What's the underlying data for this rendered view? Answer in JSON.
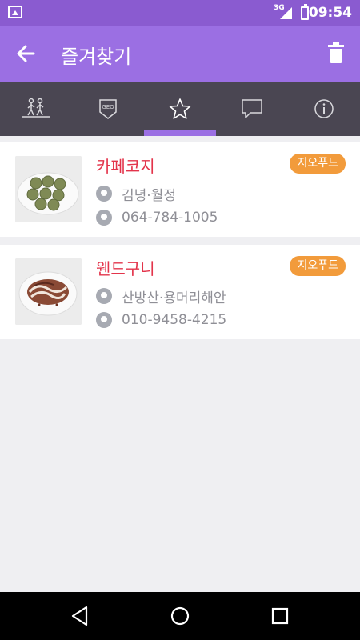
{
  "status_bar": {
    "network": "3G",
    "time": "09:54"
  },
  "app_bar": {
    "title": "즐겨찾기",
    "back_icon": "arrow-left-icon",
    "delete_icon": "trash-icon"
  },
  "tabs": [
    {
      "icon": "hikers-icon",
      "active": false
    },
    {
      "icon": "geo-icon",
      "label": "GEO",
      "active": false
    },
    {
      "icon": "star-icon",
      "active": true
    },
    {
      "icon": "chat-icon",
      "active": false
    },
    {
      "icon": "info-icon",
      "active": false
    }
  ],
  "favorites": [
    {
      "name": "카페코지",
      "category": "지오푸드",
      "location": "김녕·월정",
      "phone": "064-784-1005",
      "image": "green-muffins-plate"
    },
    {
      "name": "웬드구니",
      "category": "지오푸드",
      "location": "산방산·용머리해안",
      "phone": "010-9458-4215",
      "image": "swirl-cake-plate"
    }
  ],
  "colors": {
    "status_bar": "#8a5bd0",
    "app_bar": "#9b6fe3",
    "tab_bar": "#4a4652",
    "name_red": "#e3344b",
    "badge_orange": "#f29b3b"
  }
}
